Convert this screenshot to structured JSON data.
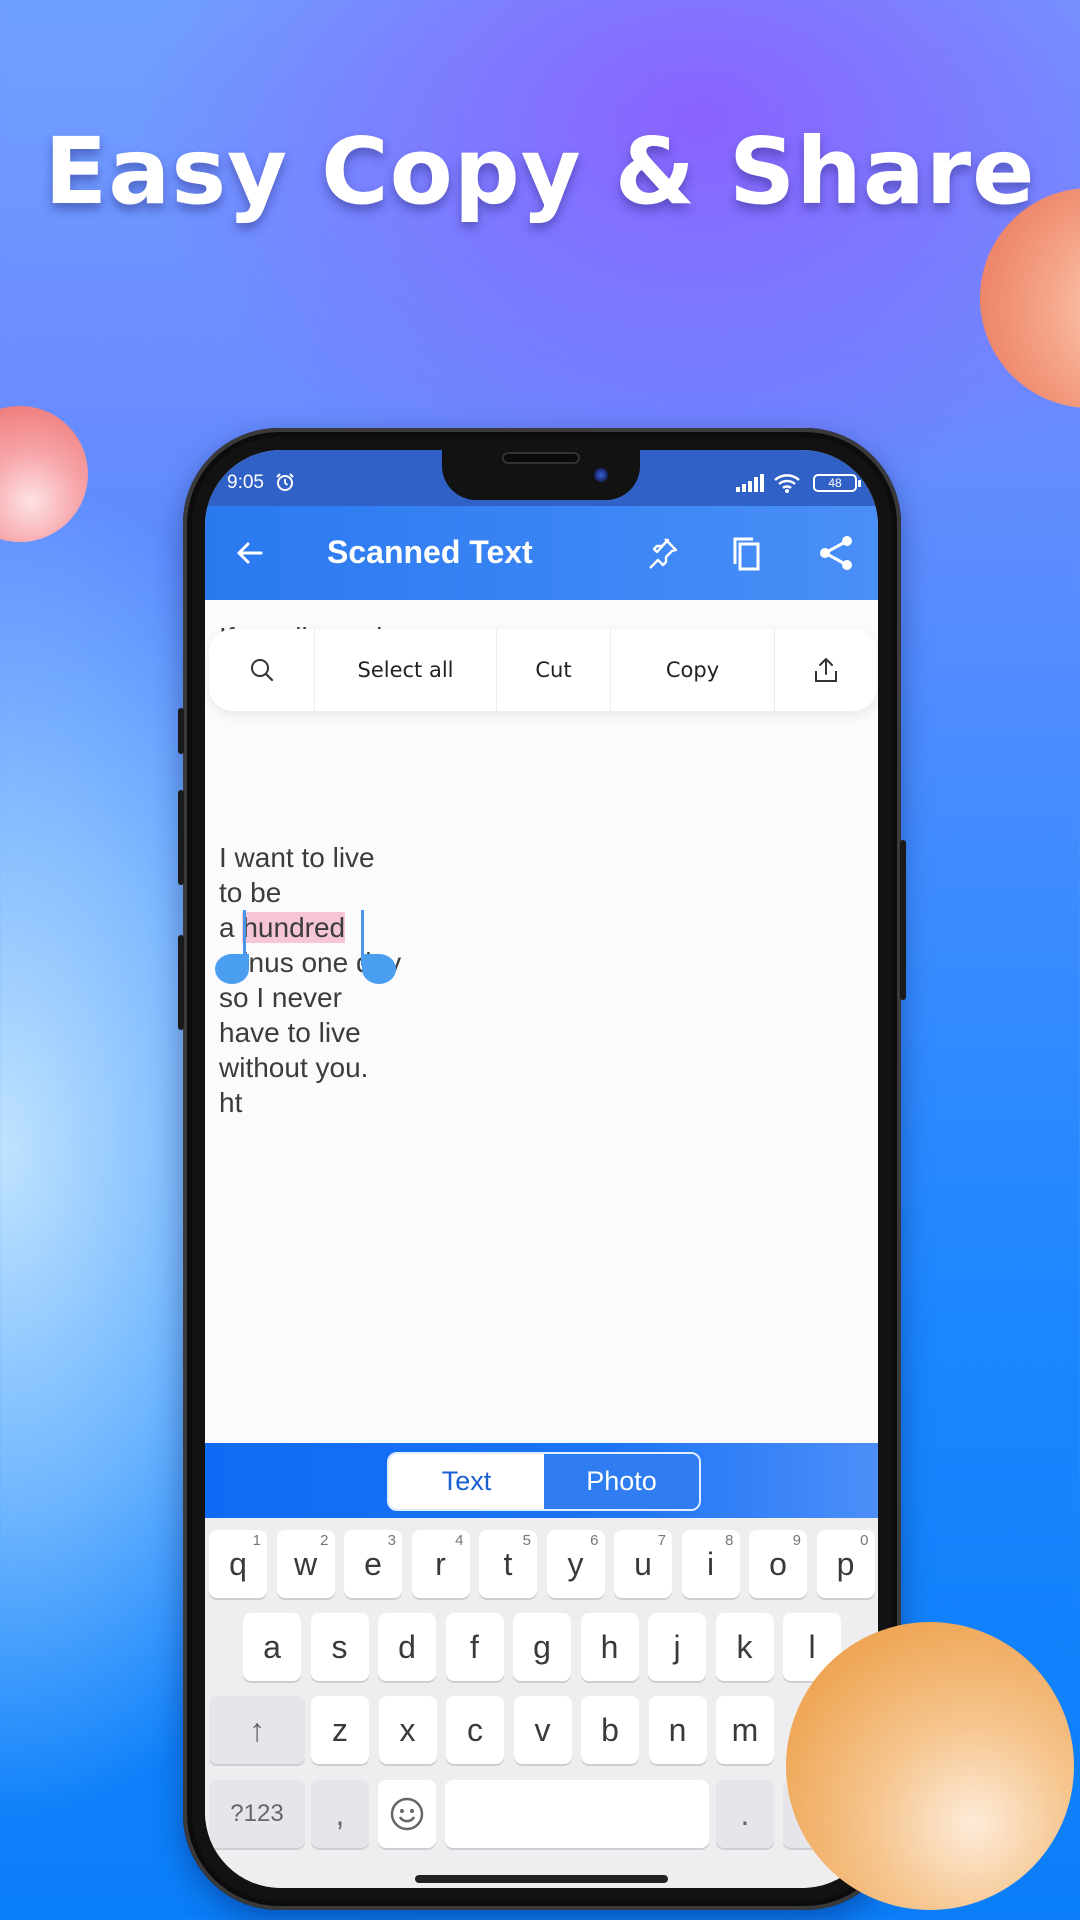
{
  "promo": {
    "headline": "Easy Copy & Share"
  },
  "status_bar": {
    "time": "9:05",
    "battery": "48",
    "icons": [
      "alarm-icon",
      "signal-icon",
      "wifi-icon",
      "battery-icon"
    ]
  },
  "app_bar": {
    "title": "Scanned Text",
    "actions": [
      "pin-icon",
      "copy-icon",
      "share-icon"
    ],
    "color": "#2f7df0"
  },
  "text_menu": {
    "items": [
      {
        "type": "icon",
        "icon": "search-icon"
      },
      {
        "type": "text",
        "label": "Select all"
      },
      {
        "type": "text",
        "label": "Cut"
      },
      {
        "type": "text",
        "label": "Copy"
      },
      {
        "type": "icon",
        "icon": "share-export-icon"
      }
    ]
  },
  "scanned_text": {
    "lines": [
      "If you live to be",
      "I want to live",
      "to be",
      "a ",
      "minus one day",
      "so I never",
      "have to live",
      "without you.",
      "ht"
    ],
    "selected_word": "hundred",
    "selection_color": "#f6c6d4",
    "handle_color": "#4a9ef0"
  },
  "mode_toggle": {
    "options": [
      "Text",
      "Photo"
    ],
    "selected": "Text"
  },
  "keyboard": {
    "row1": [
      {
        "k": "q",
        "s": "1"
      },
      {
        "k": "w",
        "s": "2"
      },
      {
        "k": "e",
        "s": "3"
      },
      {
        "k": "r",
        "s": "4"
      },
      {
        "k": "t",
        "s": "5"
      },
      {
        "k": "y",
        "s": "6"
      },
      {
        "k": "u",
        "s": "7"
      },
      {
        "k": "i",
        "s": "8"
      },
      {
        "k": "o",
        "s": "9"
      },
      {
        "k": "p",
        "s": "0"
      }
    ],
    "row2": [
      "a",
      "s",
      "d",
      "f",
      "g",
      "h",
      "j",
      "k",
      "l"
    ],
    "row3": [
      "z",
      "x",
      "c",
      "v",
      "b",
      "n",
      "m"
    ],
    "shift": "↑",
    "symbols": "?123",
    "comma": ",",
    "period": "."
  }
}
